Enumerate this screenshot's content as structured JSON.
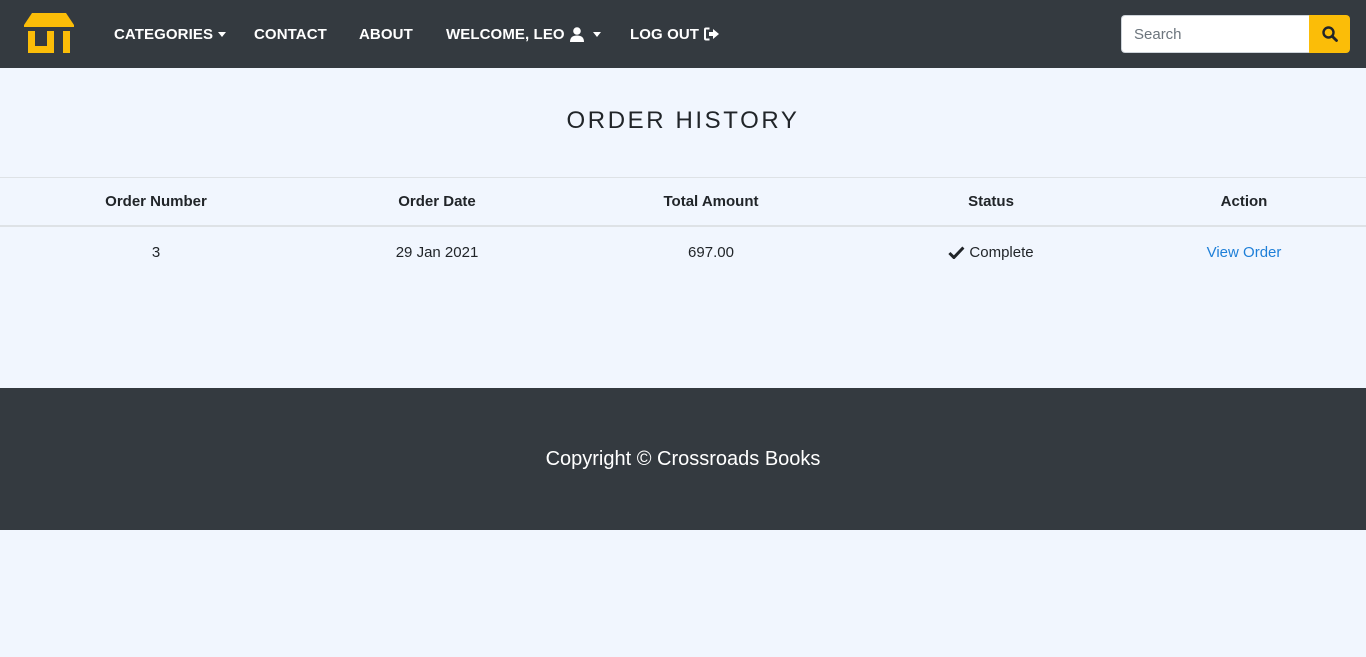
{
  "nav": {
    "categories_label": "CATEGORIES",
    "contact_label": "CONTACT",
    "about_label": "ABOUT",
    "welcome_label": "WELCOME, LEO",
    "logout_label": "LOG OUT",
    "search_placeholder": "Search",
    "logo_icon": "shop-icon",
    "accent_color": "#fbbd08",
    "navbar_color": "#343a40"
  },
  "page": {
    "title": "ORDER HISTORY"
  },
  "table": {
    "headers": [
      "Order Number",
      "Order Date",
      "Total Amount",
      "Status",
      "Action"
    ],
    "rows": [
      {
        "order_number": "3",
        "order_date": "29 Jan 2021",
        "total_amount": "697.00",
        "status": "Complete",
        "action": "View Order"
      }
    ]
  },
  "footer": {
    "copyright": "Copyright © Crossroads Books"
  }
}
